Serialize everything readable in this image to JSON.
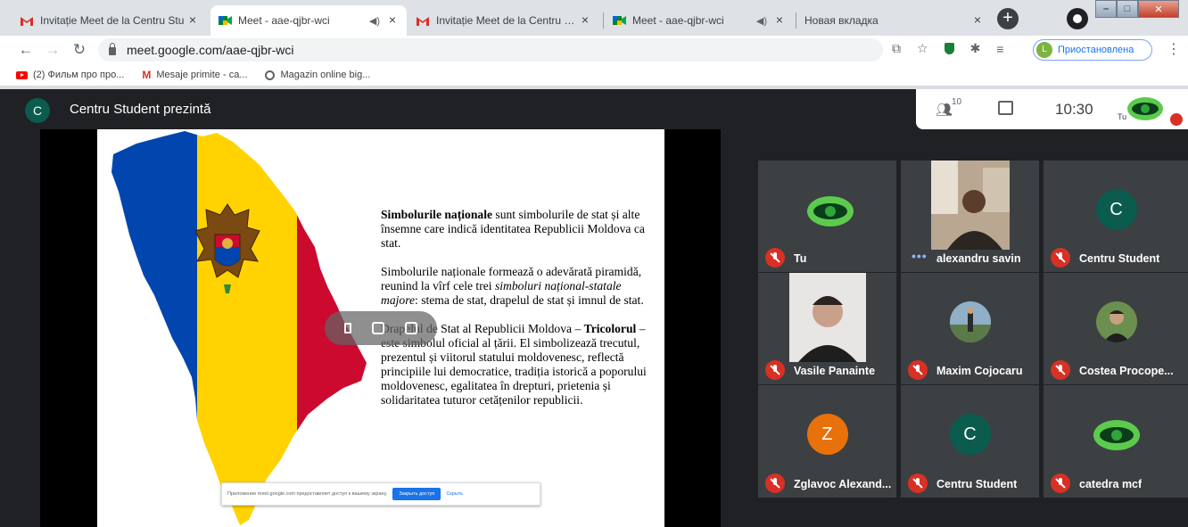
{
  "browser": {
    "tabs": [
      {
        "title": "Invitație Meet de la Centru Stu",
        "favicon": "gmail-icon",
        "active": false
      },
      {
        "title": "Meet - aae-qjbr-wci",
        "favicon": "meet-icon",
        "active": true
      },
      {
        "title": "Invitație Meet de la Centru Stu",
        "favicon": "gmail-icon",
        "active": false
      },
      {
        "title": "Meet - aae-qjbr-wci",
        "favicon": "meet-icon",
        "active": false
      },
      {
        "title": "Новая вкладка",
        "favicon": "none",
        "active": false
      }
    ],
    "url": "meet.google.com/aae-qjbr-wci",
    "profile_initial": "L",
    "profile_status": "Приостановлена",
    "bookmarks": [
      {
        "label": "(2) Фильм про про...",
        "icon": "youtube-icon"
      },
      {
        "label": "Mesaje primite - ca...",
        "icon": "gmail-icon"
      },
      {
        "label": "Magazin online big...",
        "icon": "globe-icon"
      }
    ]
  },
  "meet": {
    "presenter_initial": "C",
    "presenter_title": "Centru Student prezintă",
    "participants_count": "10",
    "time": "10:30",
    "self_label": "Tu",
    "accent": "#1a73e8",
    "mute_color": "#d93025"
  },
  "slide": {
    "p1_bold": "Simbolurile naționale",
    "p1_rest": " sunt simbolurile de stat și alte însemne care indică identitatea Republicii Moldova ca stat.",
    "p2_start": "Simbolurile naționale formează o adevărată piramidă, reunind la vîrf cele trei ",
    "p2_italic": "simboluri național-statale majore",
    "p2_end": ": stema de stat, drapelul de stat și imnul de stat.",
    "p3_start": "Drapelul de Stat al Republicii Moldova – ",
    "p3_bold": "Tricolorul",
    "p3_end": " – este simbolul oficial al țării. El simbolizează trecutul, prezentul și viitorul statului moldovenesc, reflectă principiile lui democratice, tradiția istorică a poporului moldovenesc, egalitatea în drepturi, prietenia și solidaritatea tuturor cetățenilor republicii.",
    "flag_colors": [
      "#0046ae",
      "#ffd200",
      "#cc092f"
    ]
  },
  "share_bar": {
    "message": "Приложение meet.google.com предоставляет доступ к вашему экрану.",
    "stop_label": "Закрыть доступ",
    "hide_label": "Скрыть"
  },
  "participants": [
    {
      "name": "Tu",
      "muted": true,
      "avatar": "green-logo"
    },
    {
      "name": "alexandru savin",
      "muted": false,
      "avatar": "video"
    },
    {
      "name": "Centru Student",
      "muted": true,
      "avatar": "letter",
      "initial": "C",
      "color": "#0b5b4e"
    },
    {
      "name": "Vasile Panainte",
      "muted": true,
      "avatar": "video"
    },
    {
      "name": "Maxim Cojocaru",
      "muted": true,
      "avatar": "photo"
    },
    {
      "name": "Costea Procope...",
      "muted": true,
      "avatar": "photo"
    },
    {
      "name": "Zglavoc Alexand...",
      "muted": true,
      "avatar": "letter",
      "initial": "Z",
      "color": "#e8710a"
    },
    {
      "name": "Centru Student",
      "muted": true,
      "avatar": "letter",
      "initial": "C",
      "color": "#0b5b4e"
    },
    {
      "name": "catedra mcf",
      "muted": true,
      "avatar": "green-logo"
    }
  ]
}
